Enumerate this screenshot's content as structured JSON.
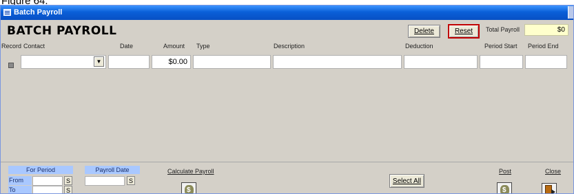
{
  "caption": "Figure 64.",
  "window": {
    "title": "Batch Payroll"
  },
  "header": {
    "title": "BATCH PAYROLL",
    "delete_label": "Delete",
    "reset_label": "Reset",
    "total_payroll_label": "Total Payroll",
    "total_payroll_value": "$0"
  },
  "columns": {
    "record": "Record",
    "contact": "Contact",
    "date": "Date",
    "amount": "Amount",
    "type": "Type",
    "description": "Description",
    "deduction": "Deduction",
    "period_start": "Period Start",
    "period_end": "Period End"
  },
  "row": {
    "amount": "$0.00"
  },
  "footer": {
    "for_period_label": "For Period",
    "payroll_date_label": "Payroll Date",
    "from_label": "From",
    "to_label": "To",
    "s_label": "S",
    "calculate_label": "Calculate Payroll",
    "select_all_label": "Select All",
    "post_label": "Post",
    "close_label": "Close"
  }
}
